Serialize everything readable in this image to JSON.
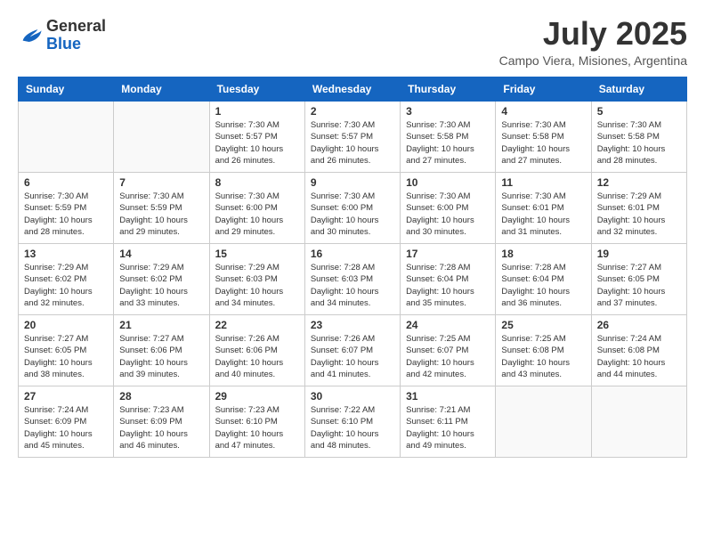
{
  "header": {
    "logo_general": "General",
    "logo_blue": "Blue",
    "title": "July 2025",
    "location": "Campo Viera, Misiones, Argentina"
  },
  "weekdays": [
    "Sunday",
    "Monday",
    "Tuesday",
    "Wednesday",
    "Thursday",
    "Friday",
    "Saturday"
  ],
  "weeks": [
    [
      {
        "day": "",
        "info": ""
      },
      {
        "day": "",
        "info": ""
      },
      {
        "day": "1",
        "info": "Sunrise: 7:30 AM\nSunset: 5:57 PM\nDaylight: 10 hours and 26 minutes."
      },
      {
        "day": "2",
        "info": "Sunrise: 7:30 AM\nSunset: 5:57 PM\nDaylight: 10 hours and 26 minutes."
      },
      {
        "day": "3",
        "info": "Sunrise: 7:30 AM\nSunset: 5:58 PM\nDaylight: 10 hours and 27 minutes."
      },
      {
        "day": "4",
        "info": "Sunrise: 7:30 AM\nSunset: 5:58 PM\nDaylight: 10 hours and 27 minutes."
      },
      {
        "day": "5",
        "info": "Sunrise: 7:30 AM\nSunset: 5:58 PM\nDaylight: 10 hours and 28 minutes."
      }
    ],
    [
      {
        "day": "6",
        "info": "Sunrise: 7:30 AM\nSunset: 5:59 PM\nDaylight: 10 hours and 28 minutes."
      },
      {
        "day": "7",
        "info": "Sunrise: 7:30 AM\nSunset: 5:59 PM\nDaylight: 10 hours and 29 minutes."
      },
      {
        "day": "8",
        "info": "Sunrise: 7:30 AM\nSunset: 6:00 PM\nDaylight: 10 hours and 29 minutes."
      },
      {
        "day": "9",
        "info": "Sunrise: 7:30 AM\nSunset: 6:00 PM\nDaylight: 10 hours and 30 minutes."
      },
      {
        "day": "10",
        "info": "Sunrise: 7:30 AM\nSunset: 6:00 PM\nDaylight: 10 hours and 30 minutes."
      },
      {
        "day": "11",
        "info": "Sunrise: 7:30 AM\nSunset: 6:01 PM\nDaylight: 10 hours and 31 minutes."
      },
      {
        "day": "12",
        "info": "Sunrise: 7:29 AM\nSunset: 6:01 PM\nDaylight: 10 hours and 32 minutes."
      }
    ],
    [
      {
        "day": "13",
        "info": "Sunrise: 7:29 AM\nSunset: 6:02 PM\nDaylight: 10 hours and 32 minutes."
      },
      {
        "day": "14",
        "info": "Sunrise: 7:29 AM\nSunset: 6:02 PM\nDaylight: 10 hours and 33 minutes."
      },
      {
        "day": "15",
        "info": "Sunrise: 7:29 AM\nSunset: 6:03 PM\nDaylight: 10 hours and 34 minutes."
      },
      {
        "day": "16",
        "info": "Sunrise: 7:28 AM\nSunset: 6:03 PM\nDaylight: 10 hours and 34 minutes."
      },
      {
        "day": "17",
        "info": "Sunrise: 7:28 AM\nSunset: 6:04 PM\nDaylight: 10 hours and 35 minutes."
      },
      {
        "day": "18",
        "info": "Sunrise: 7:28 AM\nSunset: 6:04 PM\nDaylight: 10 hours and 36 minutes."
      },
      {
        "day": "19",
        "info": "Sunrise: 7:27 AM\nSunset: 6:05 PM\nDaylight: 10 hours and 37 minutes."
      }
    ],
    [
      {
        "day": "20",
        "info": "Sunrise: 7:27 AM\nSunset: 6:05 PM\nDaylight: 10 hours and 38 minutes."
      },
      {
        "day": "21",
        "info": "Sunrise: 7:27 AM\nSunset: 6:06 PM\nDaylight: 10 hours and 39 minutes."
      },
      {
        "day": "22",
        "info": "Sunrise: 7:26 AM\nSunset: 6:06 PM\nDaylight: 10 hours and 40 minutes."
      },
      {
        "day": "23",
        "info": "Sunrise: 7:26 AM\nSunset: 6:07 PM\nDaylight: 10 hours and 41 minutes."
      },
      {
        "day": "24",
        "info": "Sunrise: 7:25 AM\nSunset: 6:07 PM\nDaylight: 10 hours and 42 minutes."
      },
      {
        "day": "25",
        "info": "Sunrise: 7:25 AM\nSunset: 6:08 PM\nDaylight: 10 hours and 43 minutes."
      },
      {
        "day": "26",
        "info": "Sunrise: 7:24 AM\nSunset: 6:08 PM\nDaylight: 10 hours and 44 minutes."
      }
    ],
    [
      {
        "day": "27",
        "info": "Sunrise: 7:24 AM\nSunset: 6:09 PM\nDaylight: 10 hours and 45 minutes."
      },
      {
        "day": "28",
        "info": "Sunrise: 7:23 AM\nSunset: 6:09 PM\nDaylight: 10 hours and 46 minutes."
      },
      {
        "day": "29",
        "info": "Sunrise: 7:23 AM\nSunset: 6:10 PM\nDaylight: 10 hours and 47 minutes."
      },
      {
        "day": "30",
        "info": "Sunrise: 7:22 AM\nSunset: 6:10 PM\nDaylight: 10 hours and 48 minutes."
      },
      {
        "day": "31",
        "info": "Sunrise: 7:21 AM\nSunset: 6:11 PM\nDaylight: 10 hours and 49 minutes."
      },
      {
        "day": "",
        "info": ""
      },
      {
        "day": "",
        "info": ""
      }
    ]
  ]
}
